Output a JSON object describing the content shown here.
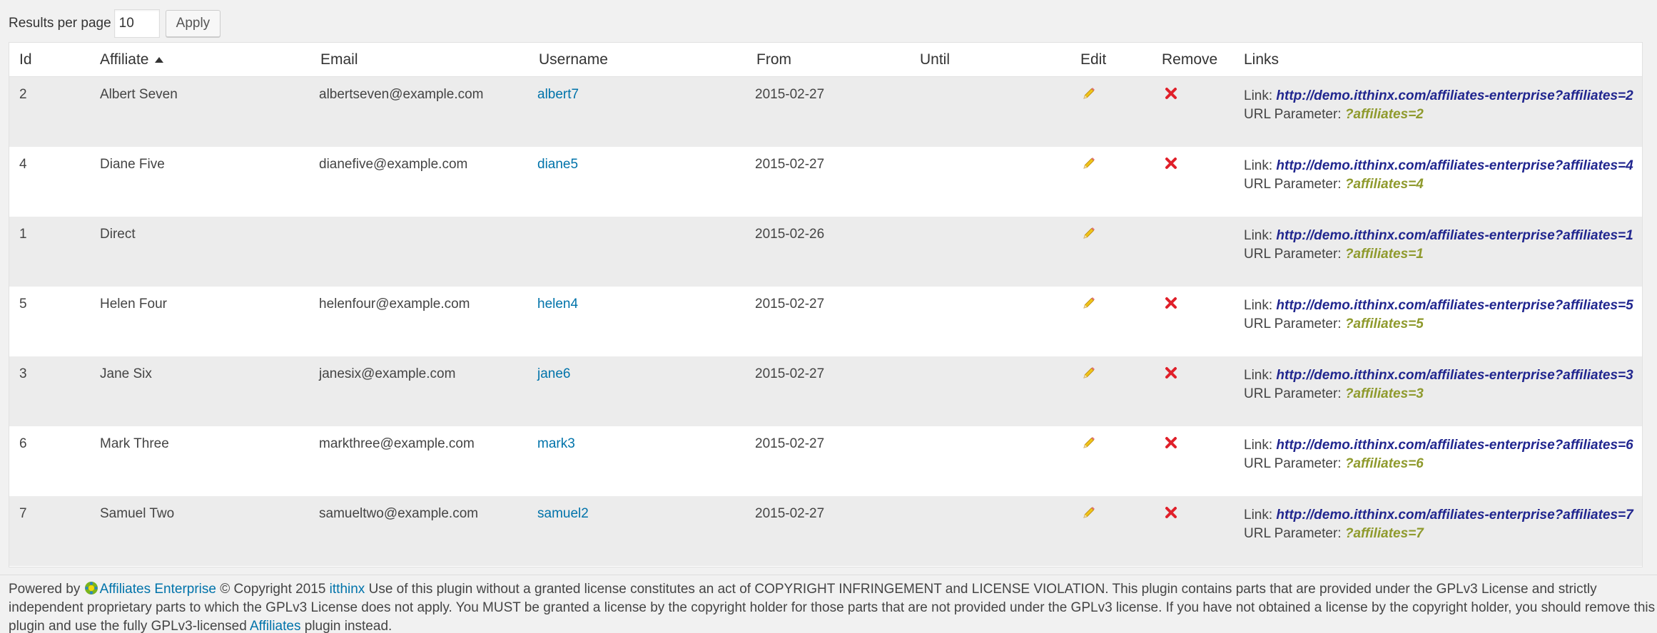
{
  "controls": {
    "results_label": "Results per page",
    "results_value": "10",
    "apply_label": "Apply"
  },
  "columns": {
    "id": "Id",
    "affiliate": "Affiliate",
    "email": "Email",
    "username": "Username",
    "from": "From",
    "until": "Until",
    "edit": "Edit",
    "remove": "Remove",
    "links": "Links"
  },
  "rows": [
    {
      "id": "2",
      "affiliate": "Albert Seven",
      "email": "albertseven@example.com",
      "username": "albert7",
      "from": "2015-02-27",
      "until": "",
      "removable": true,
      "link_label": "Link:",
      "link": "http://demo.itthinx.com/affiliates-enterprise?affiliates=2",
      "param_label": "URL Parameter:",
      "param": "?affiliates=2"
    },
    {
      "id": "4",
      "affiliate": "Diane Five",
      "email": "dianefive@example.com",
      "username": "diane5",
      "from": "2015-02-27",
      "until": "",
      "removable": true,
      "link_label": "Link:",
      "link": "http://demo.itthinx.com/affiliates-enterprise?affiliates=4",
      "param_label": "URL Parameter:",
      "param": "?affiliates=4"
    },
    {
      "id": "1",
      "affiliate": "Direct",
      "email": "",
      "username": "",
      "from": "2015-02-26",
      "until": "",
      "removable": false,
      "link_label": "Link:",
      "link": "http://demo.itthinx.com/affiliates-enterprise?affiliates=1",
      "param_label": "URL Parameter:",
      "param": "?affiliates=1"
    },
    {
      "id": "5",
      "affiliate": "Helen Four",
      "email": "helenfour@example.com",
      "username": "helen4",
      "from": "2015-02-27",
      "until": "",
      "removable": true,
      "link_label": "Link:",
      "link": "http://demo.itthinx.com/affiliates-enterprise?affiliates=5",
      "param_label": "URL Parameter:",
      "param": "?affiliates=5"
    },
    {
      "id": "3",
      "affiliate": "Jane Six",
      "email": "janesix@example.com",
      "username": "jane6",
      "from": "2015-02-27",
      "until": "",
      "removable": true,
      "link_label": "Link:",
      "link": "http://demo.itthinx.com/affiliates-enterprise?affiliates=3",
      "param_label": "URL Parameter:",
      "param": "?affiliates=3"
    },
    {
      "id": "6",
      "affiliate": "Mark Three",
      "email": "markthree@example.com",
      "username": "mark3",
      "from": "2015-02-27",
      "until": "",
      "removable": true,
      "link_label": "Link:",
      "link": "http://demo.itthinx.com/affiliates-enterprise?affiliates=6",
      "param_label": "URL Parameter:",
      "param": "?affiliates=6"
    },
    {
      "id": "7",
      "affiliate": "Samuel Two",
      "email": "samueltwo@example.com",
      "username": "samuel2",
      "from": "2015-02-27",
      "until": "",
      "removable": true,
      "link_label": "Link:",
      "link": "http://demo.itthinx.com/affiliates-enterprise?affiliates=7",
      "param_label": "URL Parameter:",
      "param": "?affiliates=7"
    }
  ],
  "icons": {
    "edit": "pencil-icon",
    "remove": "remove-x-icon",
    "sort": "sort-ascending-icon",
    "logo": "affiliates-enterprise-logo-icon"
  },
  "colors": {
    "link_blue": "#0073aa",
    "url_navy": "#21268f",
    "param_olive": "#8f9a2d",
    "remove_red": "#e0202a",
    "pencil_yellow": "#f0c419"
  },
  "footer": {
    "powered_by": "Powered by",
    "brand_link": "Affiliates Enterprise",
    "copyright": "© Copyright 2015",
    "author_link": "itthinx",
    "notice": "Use of this plugin without a granted license constitutes an act of COPYRIGHT INFRINGEMENT and LICENSE VIOLATION. This plugin contains parts that are provided under the GPLv3 License and strictly independent proprietary parts to which the GPLv3 License does not apply. You MUST be granted a license by the copyright holder for those parts that are not provided under the GPLv3 license. If you have not obtained a license by the copyright holder, you should remove this plugin and use the fully GPLv3-licensed",
    "free_link": "Affiliates",
    "tail": "plugin instead."
  }
}
